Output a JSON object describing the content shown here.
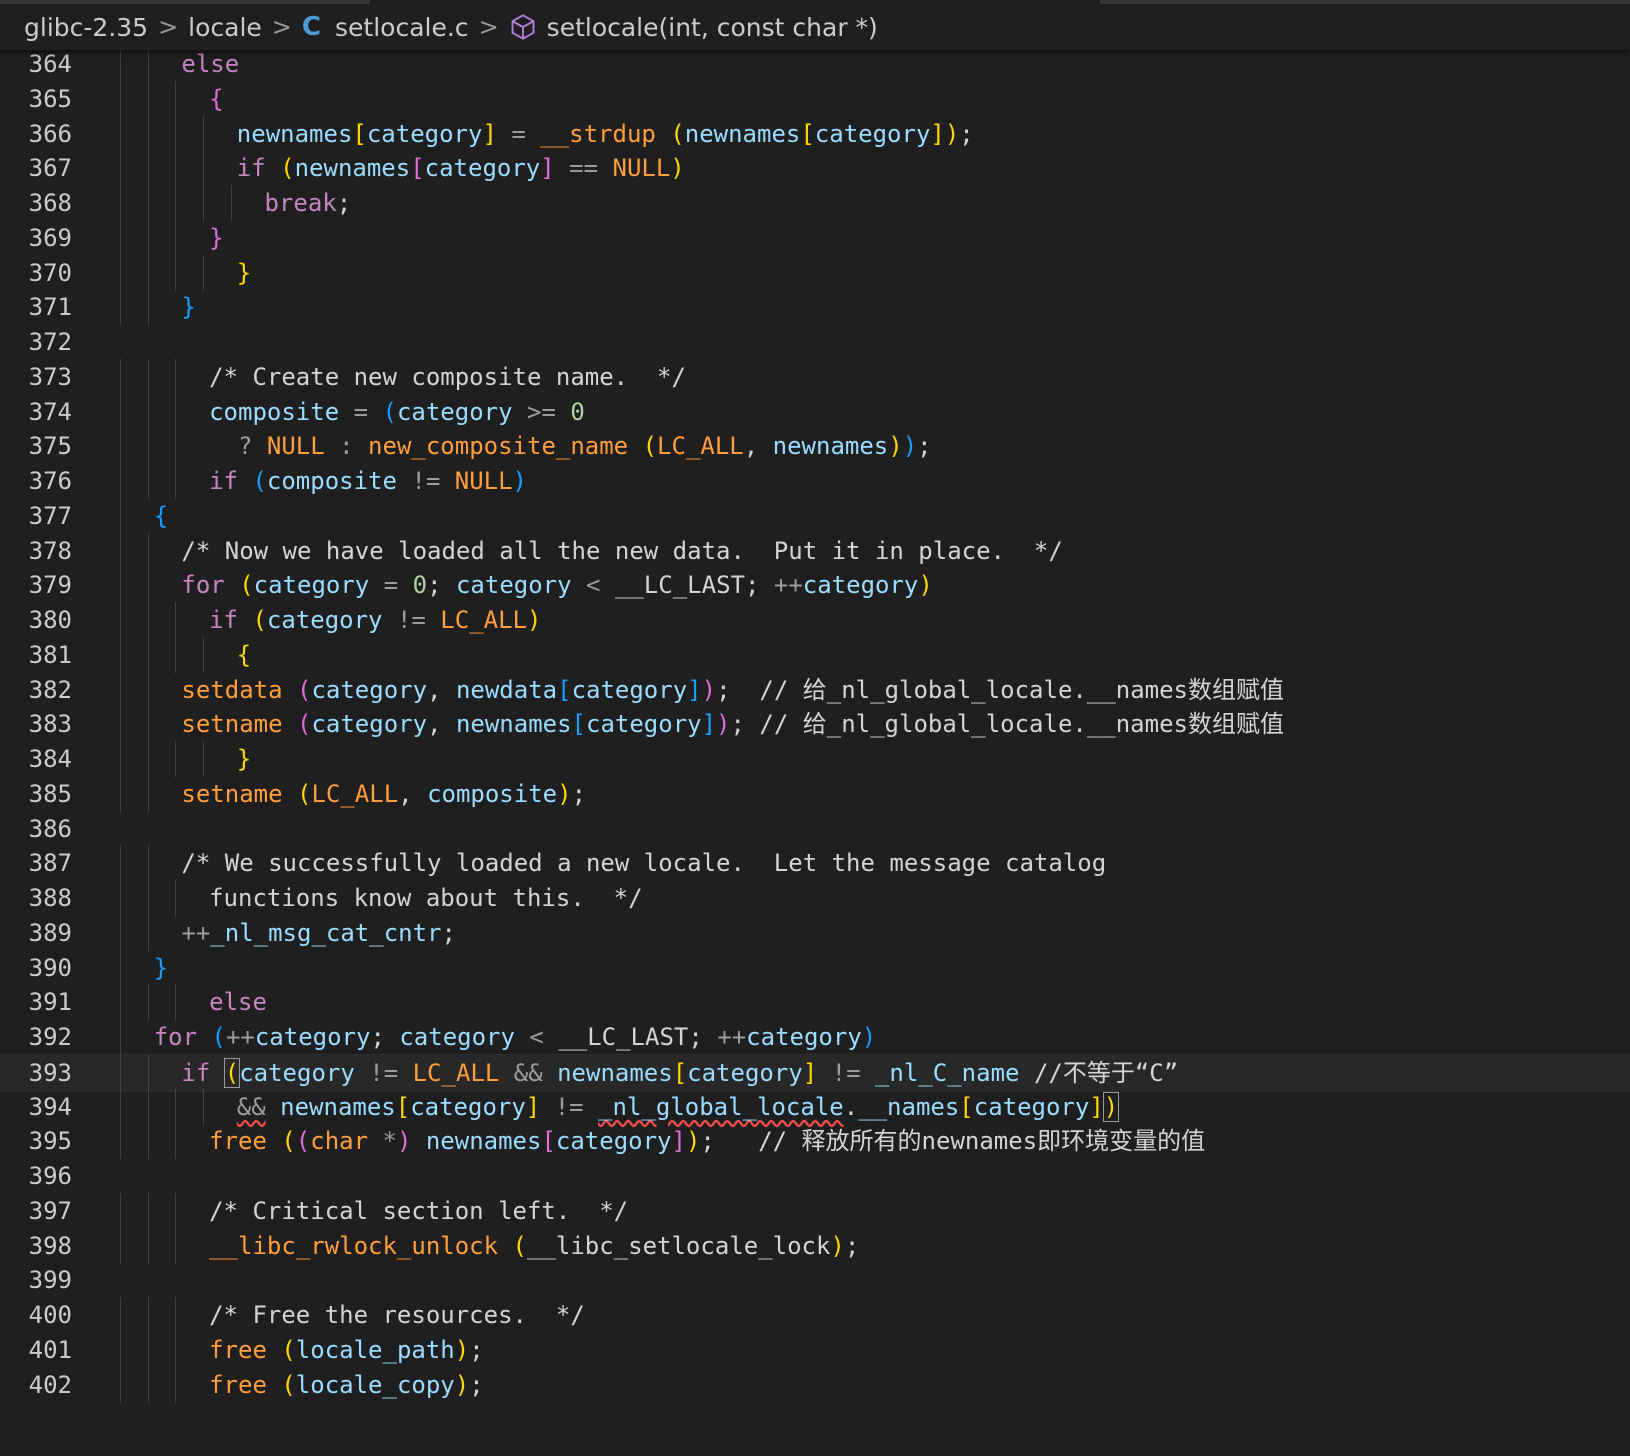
{
  "breadcrumb": {
    "folder": "glibc-2.35",
    "subfolder": "locale",
    "file_icon": "C",
    "file": "setlocale.c",
    "symbol_icon": "cube-icon",
    "symbol": "setlocale(int, const char *)",
    "separator": ">"
  },
  "editor": {
    "current_line": 393,
    "lines": [
      {
        "n": "364",
        "indent": 2,
        "tokens": [
          [
            "kw",
            "else"
          ]
        ]
      },
      {
        "n": "365",
        "indent": 3,
        "tokens": [
          [
            "br2",
            "{"
          ]
        ]
      },
      {
        "n": "366",
        "indent": 4,
        "tokens": [
          [
            "var",
            "newnames"
          ],
          [
            "br1",
            "["
          ],
          [
            "var",
            "category"
          ],
          [
            "br1",
            "]"
          ],
          [
            "op",
            " = "
          ],
          [
            "fn",
            "__strdup"
          ],
          [
            "punc",
            " "
          ],
          [
            "br1",
            "("
          ],
          [
            "var",
            "newnames"
          ],
          [
            "br1",
            "["
          ],
          [
            "var",
            "category"
          ],
          [
            "br1",
            "]"
          ],
          [
            "br1",
            ")"
          ],
          [
            "punc",
            ";"
          ]
        ]
      },
      {
        "n": "367",
        "indent": 4,
        "tokens": [
          [
            "kw",
            "if"
          ],
          [
            "punc",
            " "
          ],
          [
            "br1",
            "("
          ],
          [
            "var",
            "newnames"
          ],
          [
            "br2",
            "["
          ],
          [
            "var",
            "category"
          ],
          [
            "br2",
            "]"
          ],
          [
            "op",
            " == "
          ],
          [
            "const",
            "NULL"
          ],
          [
            "br1",
            ")"
          ]
        ]
      },
      {
        "n": "368",
        "indent": 5,
        "tokens": [
          [
            "kw",
            "break"
          ],
          [
            "punc",
            ";"
          ]
        ]
      },
      {
        "n": "369",
        "indent": 3,
        "tokens": [
          [
            "br2",
            "}"
          ]
        ]
      },
      {
        "n": "370",
        "indent": 4,
        "tokens": [
          [
            "br1",
            "}"
          ]
        ]
      },
      {
        "n": "371",
        "indent": 2,
        "tokens": [
          [
            "br3",
            "}"
          ]
        ]
      },
      {
        "n": "372",
        "indent": 0,
        "tokens": []
      },
      {
        "n": "373",
        "indent": 3,
        "tokens": [
          [
            "com",
            "/* Create new composite name.  */"
          ]
        ]
      },
      {
        "n": "374",
        "indent": 3,
        "tokens": [
          [
            "var",
            "composite"
          ],
          [
            "op",
            " = "
          ],
          [
            "br3",
            "("
          ],
          [
            "var",
            "category"
          ],
          [
            "op",
            " >= "
          ],
          [
            "num",
            "0"
          ]
        ]
      },
      {
        "n": "375",
        "indent": 3,
        "tokens": [
          [
            "op",
            "  ? "
          ],
          [
            "const",
            "NULL"
          ],
          [
            "op",
            " : "
          ],
          [
            "fn",
            "new_composite_name"
          ],
          [
            "punc",
            " "
          ],
          [
            "br1",
            "("
          ],
          [
            "const",
            "LC_ALL"
          ],
          [
            "punc",
            ", "
          ],
          [
            "var",
            "newnames"
          ],
          [
            "br1",
            ")"
          ],
          [
            "br3",
            ")"
          ],
          [
            "punc",
            ";"
          ]
        ]
      },
      {
        "n": "376",
        "indent": 3,
        "tokens": [
          [
            "kw",
            "if"
          ],
          [
            "punc",
            " "
          ],
          [
            "br3",
            "("
          ],
          [
            "var",
            "composite"
          ],
          [
            "op",
            " != "
          ],
          [
            "const",
            "NULL"
          ],
          [
            "br3",
            ")"
          ]
        ]
      },
      {
        "n": "377",
        "indent": 1,
        "tokens": [
          [
            "br3",
            "{"
          ]
        ]
      },
      {
        "n": "378",
        "indent": 2,
        "tokens": [
          [
            "com",
            "/* Now we have loaded all the new data.  Put it in place.  */"
          ]
        ]
      },
      {
        "n": "379",
        "indent": 2,
        "tokens": [
          [
            "kw",
            "for"
          ],
          [
            "punc",
            " "
          ],
          [
            "br1",
            "("
          ],
          [
            "var",
            "category"
          ],
          [
            "op",
            " = "
          ],
          [
            "num",
            "0"
          ],
          [
            "punc",
            "; "
          ],
          [
            "var",
            "category"
          ],
          [
            "op",
            " < "
          ],
          [
            "punc",
            "__LC_LAST; "
          ],
          [
            "op",
            "++"
          ],
          [
            "var",
            "category"
          ],
          [
            "br1",
            ")"
          ]
        ]
      },
      {
        "n": "380",
        "indent": 3,
        "tokens": [
          [
            "kw",
            "if"
          ],
          [
            "punc",
            " "
          ],
          [
            "br1",
            "("
          ],
          [
            "var",
            "category"
          ],
          [
            "op",
            " != "
          ],
          [
            "const",
            "LC_ALL"
          ],
          [
            "br1",
            ")"
          ]
        ]
      },
      {
        "n": "381",
        "indent": 4,
        "tokens": [
          [
            "br1",
            "{"
          ]
        ]
      },
      {
        "n": "382",
        "indent": 2,
        "tokens": [
          [
            "fn",
            "setdata"
          ],
          [
            "punc",
            " "
          ],
          [
            "br2",
            "("
          ],
          [
            "var",
            "category"
          ],
          [
            "punc",
            ", "
          ],
          [
            "var",
            "newdata"
          ],
          [
            "br3",
            "["
          ],
          [
            "var",
            "category"
          ],
          [
            "br3",
            "]"
          ],
          [
            "br2",
            ")"
          ],
          [
            "punc",
            ";  "
          ],
          [
            "com",
            "// 给_nl_global_locale.__names数组赋值"
          ]
        ]
      },
      {
        "n": "383",
        "indent": 2,
        "tokens": [
          [
            "fn",
            "setname"
          ],
          [
            "punc",
            " "
          ],
          [
            "br2",
            "("
          ],
          [
            "var",
            "category"
          ],
          [
            "punc",
            ", "
          ],
          [
            "var",
            "newnames"
          ],
          [
            "br3",
            "["
          ],
          [
            "var",
            "category"
          ],
          [
            "br3",
            "]"
          ],
          [
            "br2",
            ")"
          ],
          [
            "punc",
            "; "
          ],
          [
            "com",
            "// 给_nl_global_locale.__names数组赋值"
          ]
        ]
      },
      {
        "n": "384",
        "indent": 4,
        "tokens": [
          [
            "br1",
            "}"
          ]
        ]
      },
      {
        "n": "385",
        "indent": 2,
        "tokens": [
          [
            "fn",
            "setname"
          ],
          [
            "punc",
            " "
          ],
          [
            "br1",
            "("
          ],
          [
            "const",
            "LC_ALL"
          ],
          [
            "punc",
            ", "
          ],
          [
            "var",
            "composite"
          ],
          [
            "br1",
            ")"
          ],
          [
            "punc",
            ";"
          ]
        ]
      },
      {
        "n": "386",
        "indent": 0,
        "tokens": []
      },
      {
        "n": "387",
        "indent": 2,
        "tokens": [
          [
            "com",
            "/* We successfully loaded a new locale.  Let the message catalog"
          ]
        ]
      },
      {
        "n": "388",
        "indent": 3,
        "tokens": [
          [
            "com",
            "functions know about this.  */"
          ]
        ]
      },
      {
        "n": "389",
        "indent": 2,
        "tokens": [
          [
            "op",
            "++"
          ],
          [
            "var",
            "_nl_msg_cat_cntr"
          ],
          [
            "punc",
            ";"
          ]
        ]
      },
      {
        "n": "390",
        "indent": 1,
        "tokens": [
          [
            "br3",
            "}"
          ]
        ]
      },
      {
        "n": "391",
        "indent": 3,
        "tokens": [
          [
            "kw",
            "else"
          ]
        ]
      },
      {
        "n": "392",
        "indent": 1,
        "tokens": [
          [
            "kw",
            "for"
          ],
          [
            "punc",
            " "
          ],
          [
            "br3",
            "("
          ],
          [
            "op",
            "++"
          ],
          [
            "var",
            "category"
          ],
          [
            "punc",
            "; "
          ],
          [
            "var",
            "category"
          ],
          [
            "op",
            " < "
          ],
          [
            "punc",
            "__LC_LAST; "
          ],
          [
            "op",
            "++"
          ],
          [
            "var",
            "category"
          ],
          [
            "br3",
            ")"
          ]
        ]
      },
      {
        "n": "393",
        "indent": 2,
        "tokens": [
          [
            "kw",
            "if"
          ],
          [
            "punc",
            " "
          ],
          [
            "br1box",
            "("
          ],
          [
            "var",
            "category"
          ],
          [
            "op",
            " != "
          ],
          [
            "const",
            "LC_ALL"
          ],
          [
            "op",
            " && "
          ],
          [
            "var",
            "newnames"
          ],
          [
            "br1",
            "["
          ],
          [
            "var",
            "category"
          ],
          [
            "br1",
            "]"
          ],
          [
            "op",
            " != "
          ],
          [
            "var",
            "_nl_C_name"
          ],
          [
            "punc",
            " "
          ],
          [
            "com",
            "//不等于“C”"
          ]
        ]
      },
      {
        "n": "394",
        "indent": 4,
        "tokens": [
          [
            "sqop",
            "&&"
          ],
          [
            "punc",
            " "
          ],
          [
            "var",
            "newnames"
          ],
          [
            "br1",
            "["
          ],
          [
            "var",
            "category"
          ],
          [
            "br1",
            "]"
          ],
          [
            "op",
            " != "
          ],
          [
            "sqvar",
            "_nl_global_locale"
          ],
          [
            "punc",
            "."
          ],
          [
            "var",
            "__names"
          ],
          [
            "br1",
            "["
          ],
          [
            "var",
            "category"
          ],
          [
            "br1",
            "]"
          ],
          [
            "br1box",
            ")"
          ]
        ]
      },
      {
        "n": "395",
        "indent": 3,
        "tokens": [
          [
            "fn",
            "free"
          ],
          [
            "punc",
            " "
          ],
          [
            "br1",
            "("
          ],
          [
            "br2",
            "("
          ],
          [
            "type",
            "char"
          ],
          [
            "op",
            " *"
          ],
          [
            "br2",
            ")"
          ],
          [
            "punc",
            " "
          ],
          [
            "var",
            "newnames"
          ],
          [
            "br2",
            "["
          ],
          [
            "var",
            "category"
          ],
          [
            "br2",
            "]"
          ],
          [
            "br1",
            ")"
          ],
          [
            "punc",
            ";   "
          ],
          [
            "com",
            "// 释放所有的newnames即环境变量的值"
          ]
        ]
      },
      {
        "n": "396",
        "indent": 0,
        "tokens": []
      },
      {
        "n": "397",
        "indent": 3,
        "tokens": [
          [
            "com",
            "/* Critical section left.  */"
          ]
        ]
      },
      {
        "n": "398",
        "indent": 3,
        "tokens": [
          [
            "fn",
            "__libc_rwlock_unlock"
          ],
          [
            "punc",
            " "
          ],
          [
            "br1",
            "("
          ],
          [
            "punc",
            "__libc_setlocale_lock"
          ],
          [
            "br1",
            ")"
          ],
          [
            "punc",
            ";"
          ]
        ]
      },
      {
        "n": "399",
        "indent": 0,
        "tokens": []
      },
      {
        "n": "400",
        "indent": 3,
        "tokens": [
          [
            "com",
            "/* Free the resources.  */"
          ]
        ]
      },
      {
        "n": "401",
        "indent": 3,
        "tokens": [
          [
            "fn",
            "free"
          ],
          [
            "punc",
            " "
          ],
          [
            "br1",
            "("
          ],
          [
            "var",
            "locale_path"
          ],
          [
            "br1",
            ")"
          ],
          [
            "punc",
            ";"
          ]
        ]
      },
      {
        "n": "402",
        "indent": 3,
        "tokens": [
          [
            "fn",
            "free"
          ],
          [
            "punc",
            " "
          ],
          [
            "br1",
            "("
          ],
          [
            "var",
            "locale_copy"
          ],
          [
            "br1",
            ")"
          ],
          [
            "punc",
            ";"
          ]
        ]
      }
    ]
  },
  "colors": {
    "background": "#1f1f1f",
    "line_number": "#cccccc",
    "keyword": "#c586c0",
    "variable": "#9cdcfe",
    "function": "#ff9e3d",
    "bracket_1": "#ffd700",
    "bracket_2": "#da70d6",
    "bracket_3": "#179fff",
    "comment": "#d4d4d4",
    "error_squiggle": "#f14c4c"
  }
}
